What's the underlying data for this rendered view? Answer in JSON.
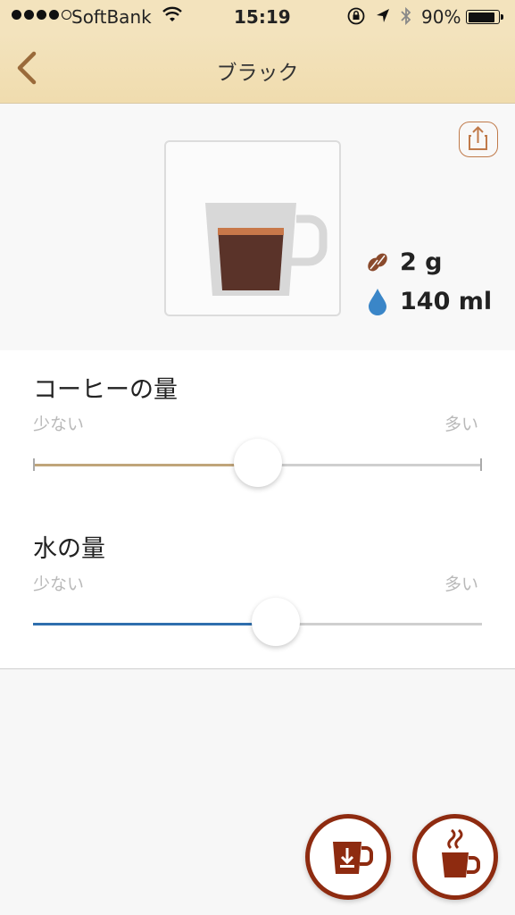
{
  "status": {
    "carrier": "SoftBank",
    "time": "15:19",
    "battery": "90%"
  },
  "nav": {
    "title": "ブラック"
  },
  "preview": {
    "beans": "2 g",
    "water": "140 ml"
  },
  "coffee_amount": {
    "title": "コーヒーの量",
    "min_label": "少ない",
    "max_label": "多い",
    "value_fraction": 0.5,
    "color": "#c0a57a"
  },
  "water_amount": {
    "title": "水の量",
    "min_label": "少ない",
    "max_label": "多い",
    "value_fraction": 0.54,
    "color": "#2f6fae"
  },
  "colors": {
    "header": "#f3e3bd",
    "accent": "#8e2b10",
    "back_arrow": "#9a6a3a"
  }
}
